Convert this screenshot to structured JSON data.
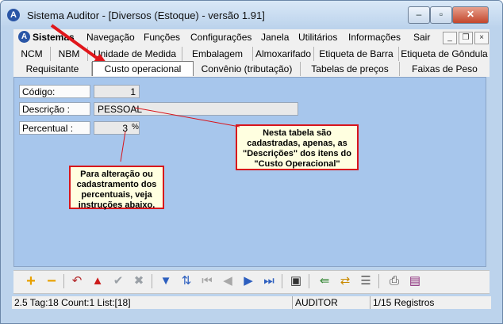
{
  "window": {
    "title": "Sistema Auditor - [Diversos (Estoque) - versão 1.91]",
    "app_icon_glyph": "A",
    "minimize": "–",
    "restore": "▫",
    "close": "✕"
  },
  "menu": {
    "icon_glyph": "A",
    "items": [
      "Sistemas",
      "Navegação",
      "Funções",
      "Configurações",
      "Janela",
      "Utilitários",
      "Informações",
      "Sair"
    ],
    "mdi_min": "_",
    "mdi_restore": "❐",
    "mdi_close": "×"
  },
  "tabs": {
    "row1": [
      "NCM",
      "NBM",
      "Unidade de Medida",
      "Embalagem",
      "Almoxarifado",
      "Etiqueta de Barra",
      "Etiqueta de Gôndula"
    ],
    "row2": [
      "Requisitante",
      "Custo operacional",
      "Convênio (tributação)",
      "Tabelas de preços",
      "Faixas de Peso"
    ],
    "active": "Custo operacional"
  },
  "form": {
    "codigo_label": "Código:",
    "codigo_value": "1",
    "descricao_label": "Descrição :",
    "descricao_value": "PESSOAL",
    "percentual_label": "Percentual :",
    "percentual_value": "3",
    "percentual_suffix": "%"
  },
  "callouts": {
    "descricao_note": "Nesta tabela são cadastradas, apenas, as \"Descrições\" dos itens do \"Custo Operacional\"",
    "percentual_note": "Para alteração ou cadastramento dos percentuais, veja instruções abaixo."
  },
  "statusbar": {
    "left": "2.5 Tag:18 Count:1 List:[18]",
    "user": "AUDITOR",
    "records": "1/15 Registros"
  },
  "colors": {
    "accent_red": "#d8151b",
    "content_bg": "#a7c6ec",
    "callout_bg": "#ffffe0"
  }
}
